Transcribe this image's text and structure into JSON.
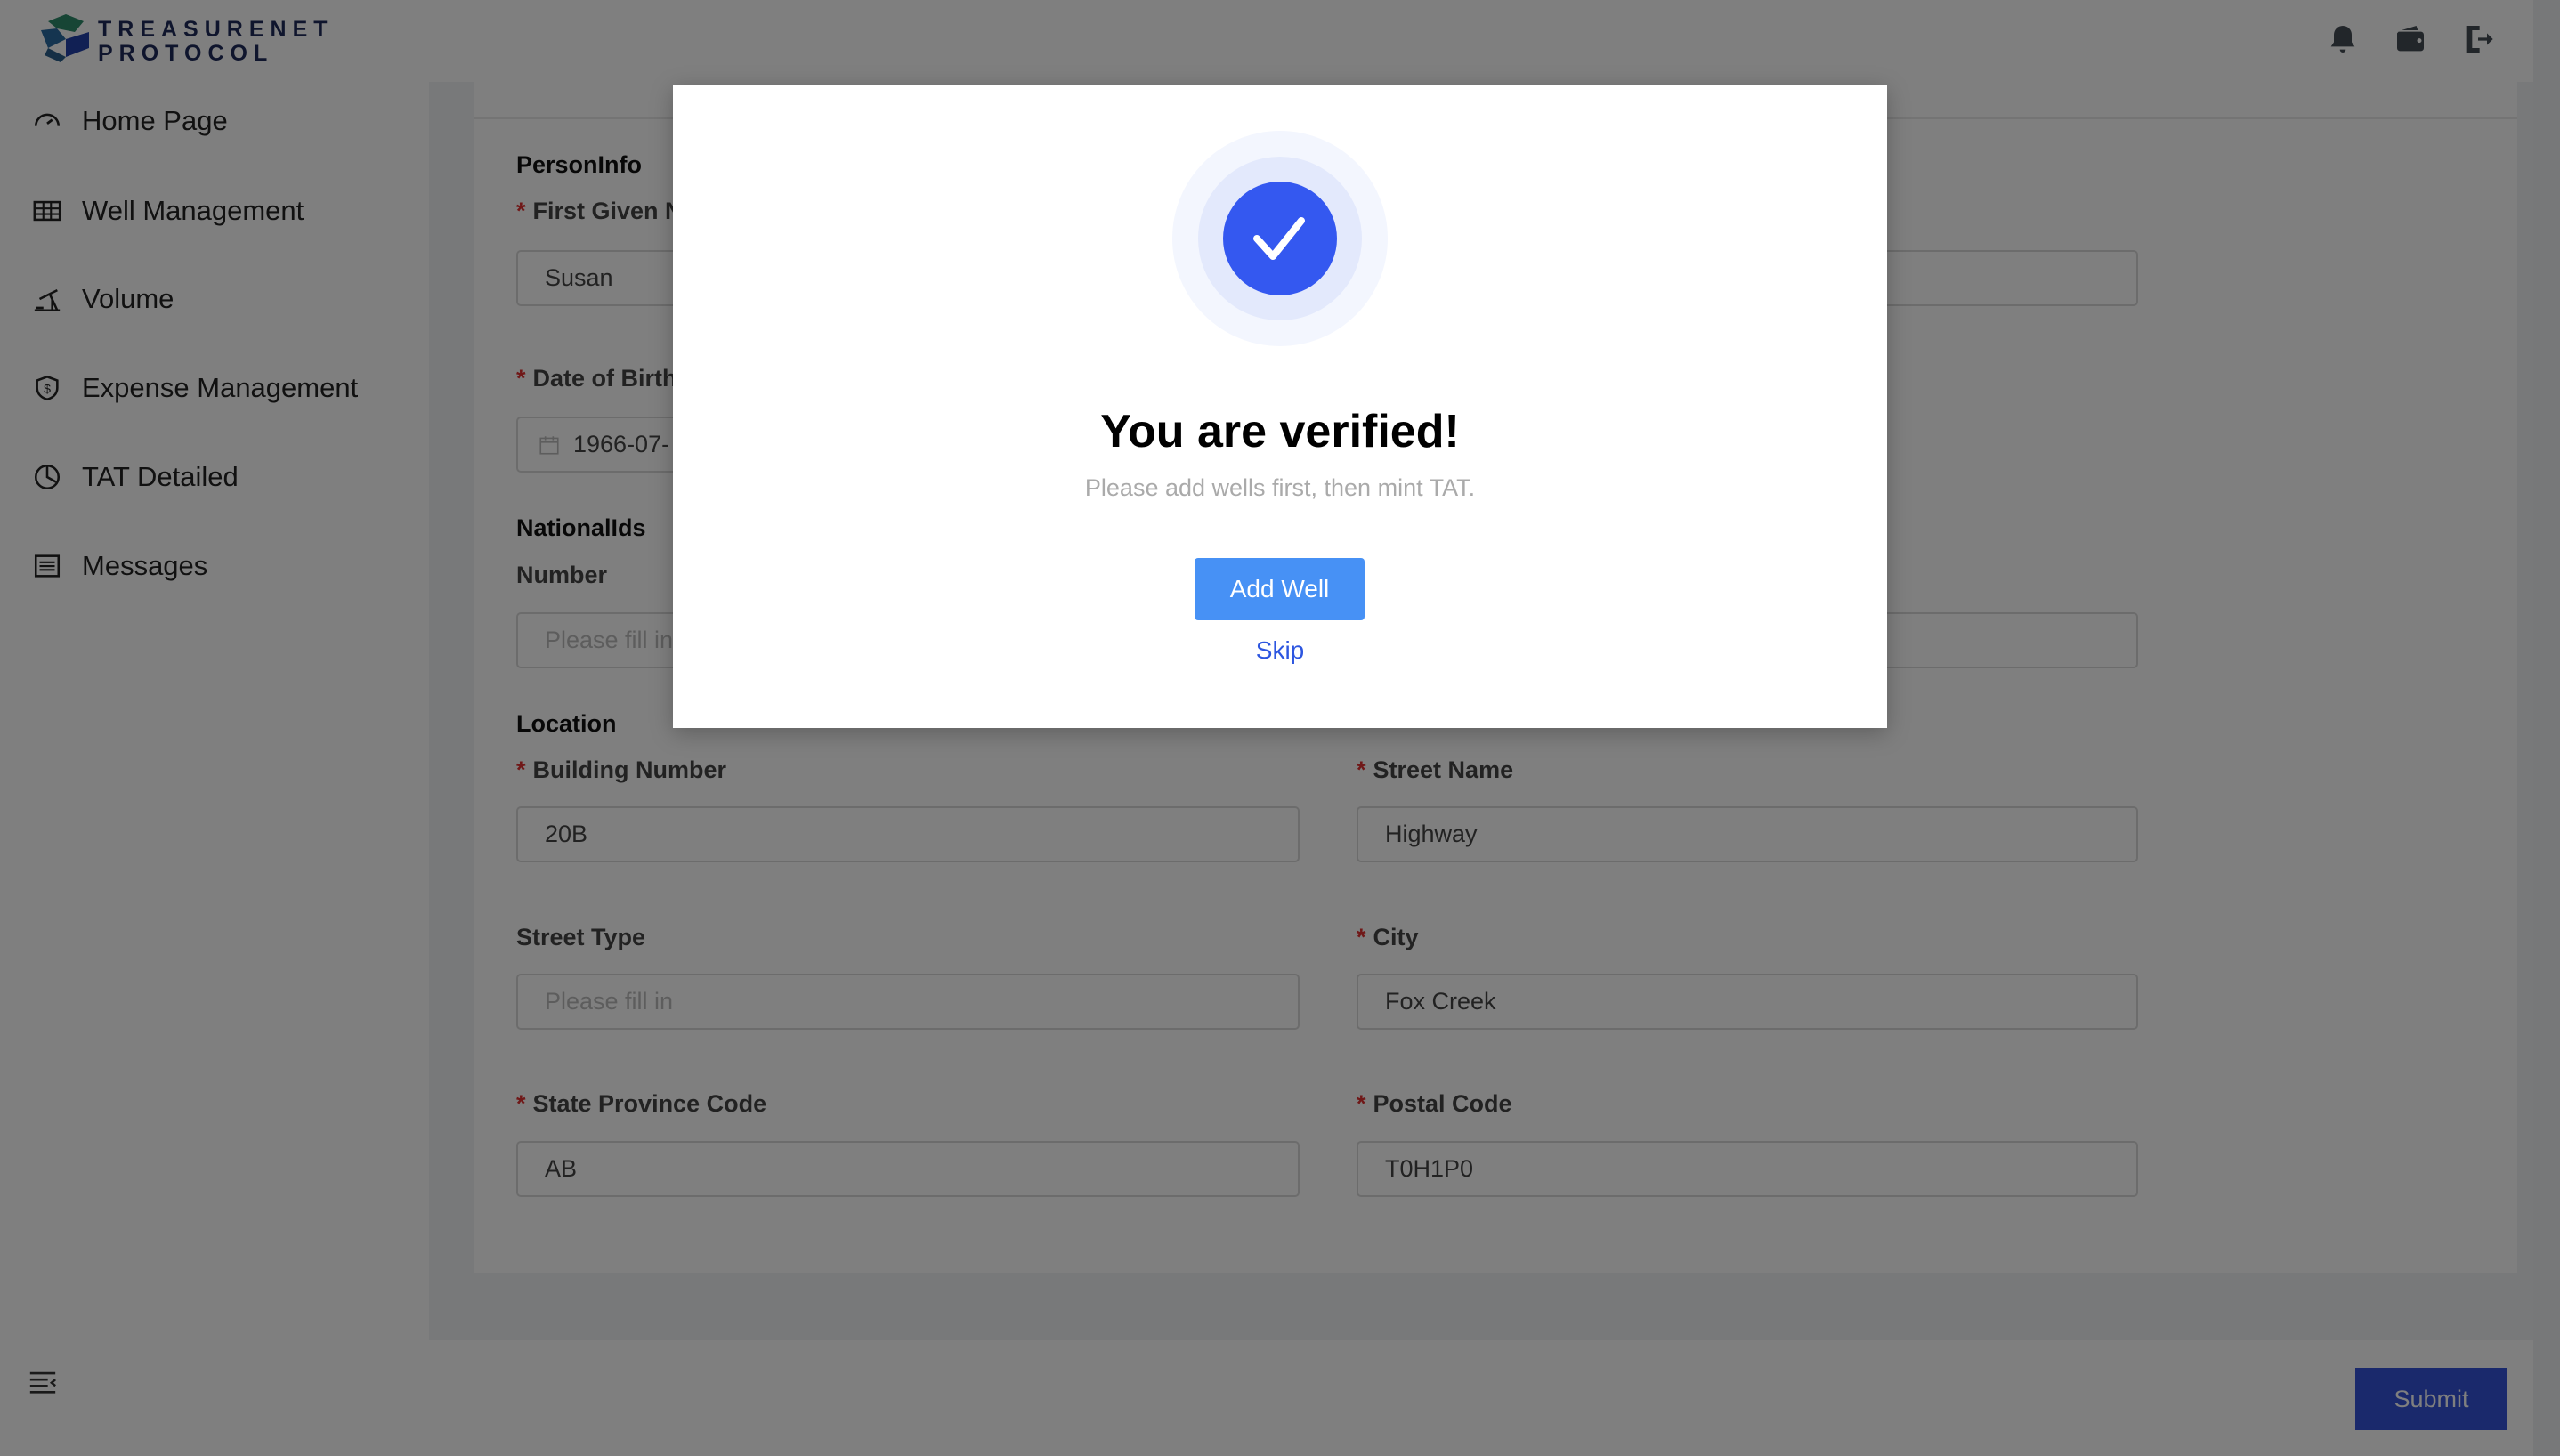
{
  "header": {
    "logo_line1": "TREASURENET",
    "logo_line2": "PROTOCOL",
    "icons": [
      "bell-icon",
      "wallet-icon",
      "logout-icon"
    ]
  },
  "sidebar": {
    "items": [
      {
        "label": "Home Page",
        "icon": "dashboard-gauge-icon"
      },
      {
        "label": "Well Management",
        "icon": "table-icon"
      },
      {
        "label": "Volume",
        "icon": "pumpjack-icon"
      },
      {
        "label": "Expense Management",
        "icon": "shield-dollar-icon"
      },
      {
        "label": "TAT Detailed",
        "icon": "pie-chart-icon"
      },
      {
        "label": "Messages",
        "icon": "list-icon"
      }
    ],
    "collapse_icon": "menu-fold-icon"
  },
  "form": {
    "person_info": "PersonInfo",
    "first_given_name_label": "First Given N",
    "first_given_name_value": "Susan",
    "dob_label": "Date of Birth",
    "dob_value": "1966-07-",
    "national_ids": "NationalIds",
    "number_label": "Number",
    "number_placeholder": "Please fill in",
    "location": "Location",
    "building_number_label": "Building Number",
    "building_number_value": "20B",
    "street_name_label": "Street Name",
    "street_name_value": "Highway",
    "street_type_label": "Street Type",
    "street_type_placeholder": "Please fill in",
    "city_label": "City",
    "city_value": "Fox Creek",
    "state_label": "State Province Code",
    "state_value": "AB",
    "postal_label": "Postal Code",
    "postal_value": "T0H1P0",
    "required_mark": "*"
  },
  "footer": {
    "submit_label": "Submit"
  },
  "modal": {
    "title": "You are verified!",
    "subtitle": "Please add wells first, then mint TAT.",
    "add_well_label": "Add Well",
    "skip_label": "Skip",
    "icon": "check-circle-icon",
    "accent": "#3458f0"
  }
}
